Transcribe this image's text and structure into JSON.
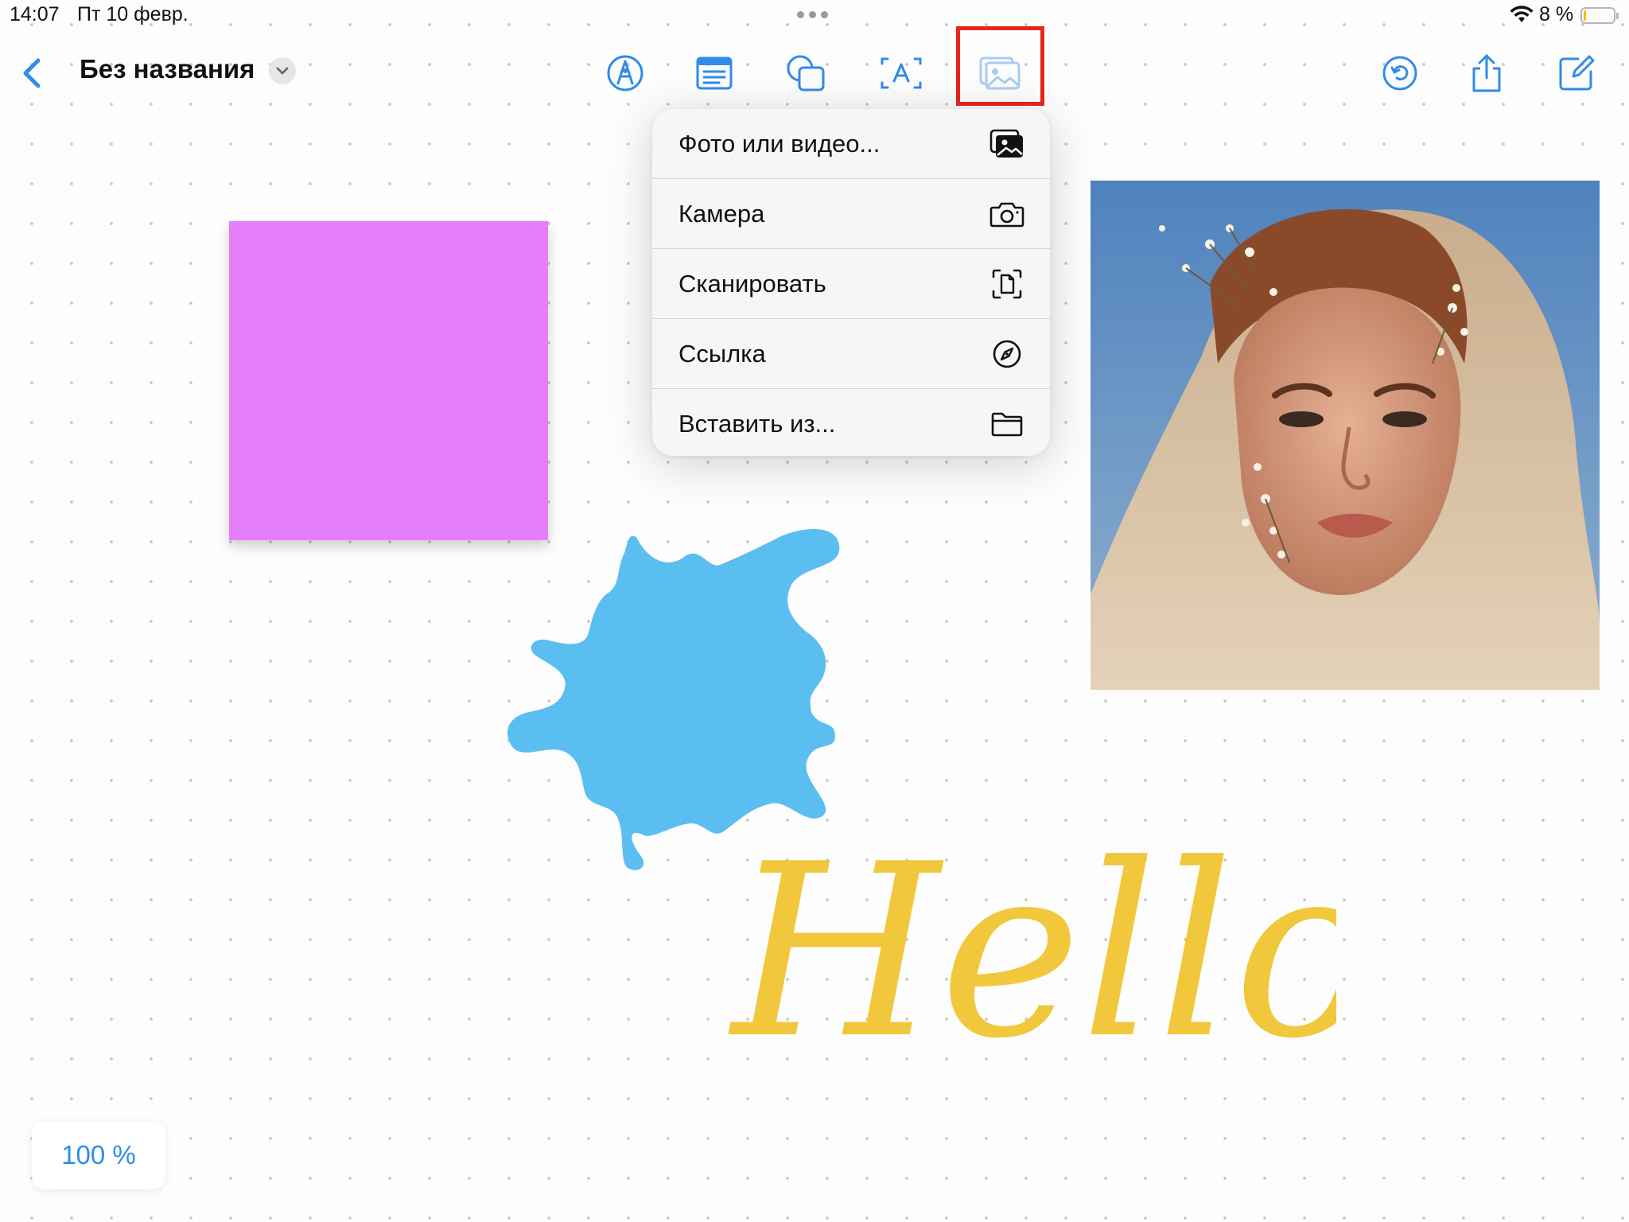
{
  "status_bar": {
    "time": "14:07",
    "date": "Пт 10 февр.",
    "battery_percent": "8 %",
    "battery_level": 0.08,
    "wifi_icon": "wifi-icon"
  },
  "nav": {
    "back_icon": "chevron-left-icon",
    "title": "Без названия",
    "title_menu_icon": "chevron-down-icon"
  },
  "toolbar": {
    "tools": [
      {
        "name": "pen-tool-icon"
      },
      {
        "name": "sticky-note-icon"
      },
      {
        "name": "shapes-icon"
      },
      {
        "name": "text-box-icon"
      },
      {
        "name": "media-icon",
        "active": true,
        "highlighted": true
      }
    ],
    "right_actions": [
      {
        "name": "collaborate-icon"
      },
      {
        "name": "share-icon"
      },
      {
        "name": "compose-icon"
      }
    ]
  },
  "insert_menu": {
    "items": [
      {
        "label": "Фото или видео...",
        "icon": "photos-icon"
      },
      {
        "label": "Камера",
        "icon": "camera-icon"
      },
      {
        "label": "Сканировать",
        "icon": "scan-document-icon"
      },
      {
        "label": "Ссылка",
        "icon": "compass-link-icon"
      },
      {
        "label": "Вставить из...",
        "icon": "folder-icon"
      }
    ]
  },
  "canvas": {
    "sticky_note_color": "#e47ff9",
    "splash_color": "#5bbef0",
    "handwritten_text": "Hello",
    "handwritten_color": "#f1c83c",
    "photo": "portrait-photo"
  },
  "zoom_level": "100 %",
  "colors": {
    "accent": "#2f8ce8",
    "highlight_box": "#e8261d"
  }
}
